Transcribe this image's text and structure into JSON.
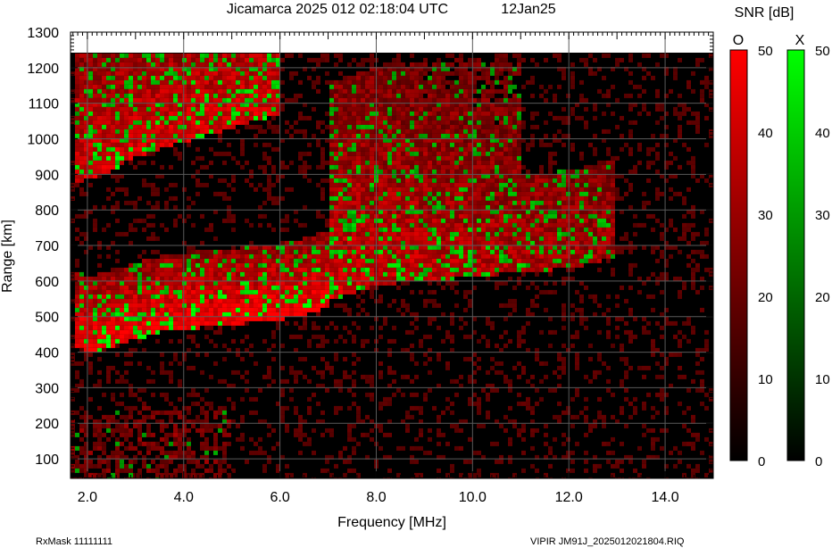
{
  "chart_data": {
    "type": "heatmap",
    "title": "Jicamarca 2025 012 02:18:04 UTC",
    "date_label": "12Jan25",
    "xlabel": "Frequency [MHz]",
    "ylabel": "Range [km]",
    "xlim": [
      1.65,
      15.0
    ],
    "ylim": [
      45,
      1300
    ],
    "x_ticks": [
      "2.0",
      "4.0",
      "6.0",
      "8.0",
      "10.0",
      "12.0",
      "14.0"
    ],
    "x_tick_values": [
      2.0,
      4.0,
      6.0,
      8.0,
      10.0,
      12.0,
      14.0
    ],
    "y_ticks": [
      "100",
      "200",
      "300",
      "400",
      "500",
      "600",
      "700",
      "800",
      "900",
      "1000",
      "1100",
      "1200",
      "1300"
    ],
    "y_tick_values": [
      100,
      200,
      300,
      400,
      500,
      600,
      700,
      800,
      900,
      1000,
      1100,
      1200,
      1300
    ],
    "grid": true,
    "data_top_km": 1240,
    "colorbar_title": "SNR [dB]",
    "colorbars": [
      {
        "name": "O",
        "color_low": "#000000",
        "color_high": "#ff0000",
        "range": [
          0,
          50
        ],
        "ticks": [
          "0",
          "10",
          "20",
          "30",
          "40",
          "50"
        ]
      },
      {
        "name": "X",
        "color_low": "#000000",
        "color_high": "#00ff00",
        "range": [
          0,
          50
        ],
        "ticks": [
          "0",
          "10",
          "20",
          "30",
          "40",
          "50"
        ]
      }
    ],
    "echo_traces": [
      {
        "mode": "O",
        "freq": [
          1.7,
          2.0,
          2.5,
          3.0,
          3.5,
          4.0,
          4.5,
          5.0,
          5.5,
          6.0,
          6.5,
          7.0
        ],
        "range_km": [
          440,
          410,
          430,
          450,
          470,
          480,
          485,
          490,
          500,
          505,
          520,
          540
        ]
      },
      {
        "mode": "O",
        "freq": [
          7.0,
          7.5,
          8.0,
          8.5,
          9.0,
          9.5,
          10.0,
          11.0,
          12.0,
          13.0
        ],
        "range_km": [
          560,
          580,
          600,
          610,
          615,
          620,
          625,
          640,
          650,
          680
        ]
      },
      {
        "mode": "O",
        "freq": [
          1.7,
          2.5,
          3.0,
          3.5,
          4.0,
          5.0,
          6.0
        ],
        "range_km": [
          880,
          920,
          960,
          980,
          1000,
          1040,
          1080
        ]
      }
    ]
  },
  "footer": {
    "rxmask": "RxMask 11111111",
    "file": "VIPIR  JM91J_2025012021804.RIQ"
  }
}
